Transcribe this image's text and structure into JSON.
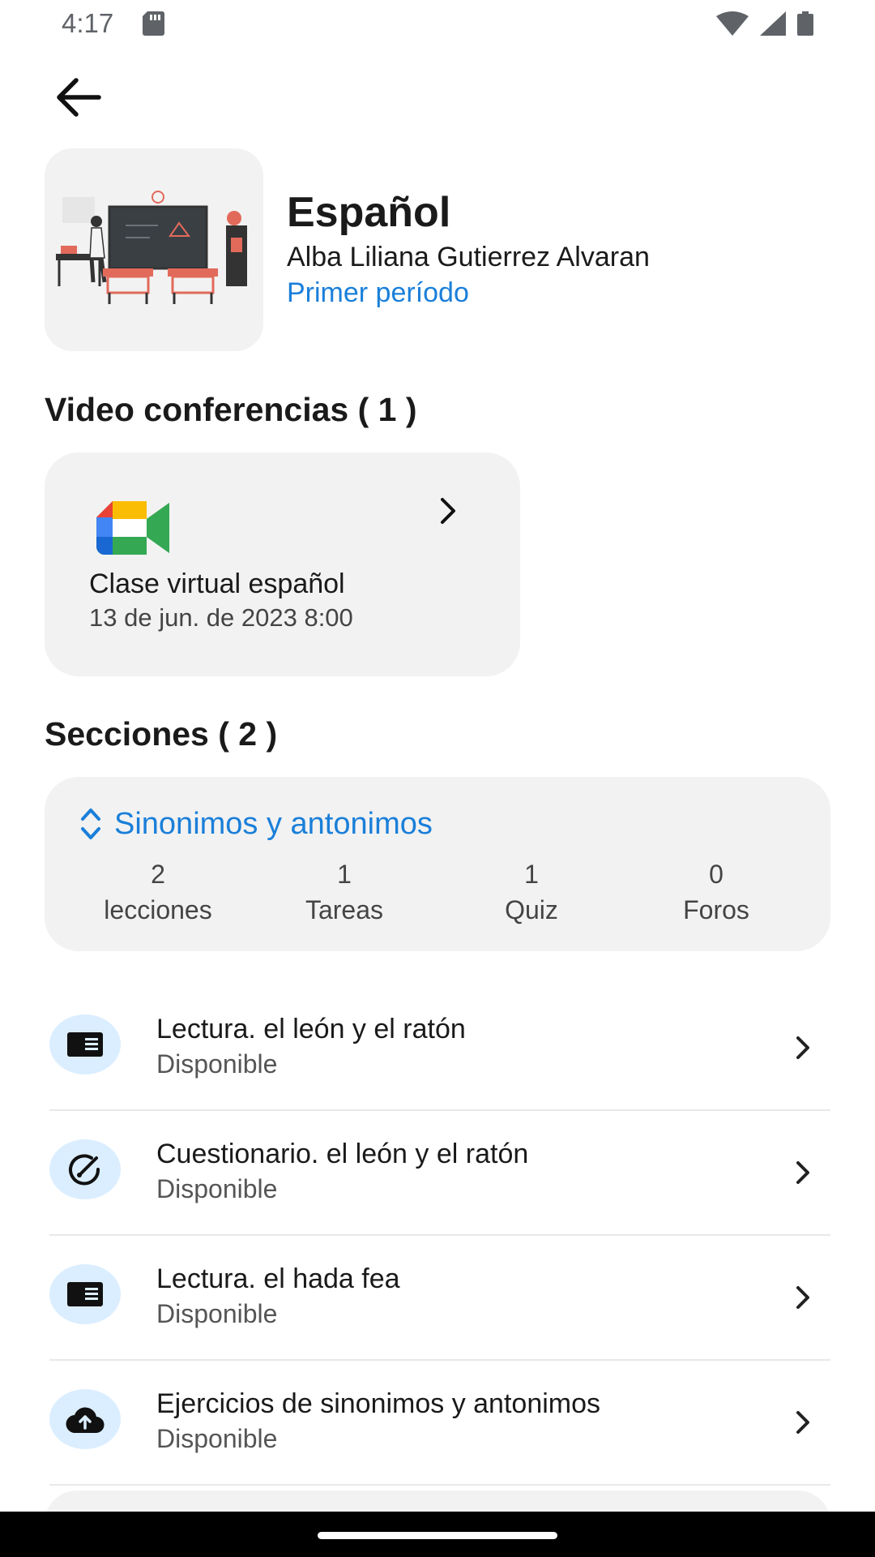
{
  "status_bar": {
    "time": "4:17"
  },
  "course": {
    "title": "Español",
    "teacher": "Alba Liliana Gutierrez Alvaran",
    "period": "Primer período"
  },
  "video_conferences": {
    "heading": "Video conferencias ( 1 )",
    "items": [
      {
        "title": "Clase virtual español",
        "date": "13 de jun. de 2023 8:00",
        "icon": "google-meet-logo"
      }
    ]
  },
  "sections": {
    "heading": "Secciones ( 2 )",
    "current": {
      "name": "Sinonimos y antonimos",
      "stats": [
        {
          "value": "2",
          "label": "lecciones"
        },
        {
          "value": "1",
          "label": "Tareas"
        },
        {
          "value": "1",
          "label": "Quiz"
        },
        {
          "value": "0",
          "label": "Foros"
        }
      ]
    },
    "items": [
      {
        "title": "Lectura. el león y el ratón",
        "status": "Disponible",
        "icon": "reading-icon"
      },
      {
        "title": "Cuestionario. el león y el ratón",
        "status": "Disponible",
        "icon": "quiz-icon"
      },
      {
        "title": "Lectura. el hada fea",
        "status": "Disponible",
        "icon": "reading-icon"
      },
      {
        "title": "Ejercicios de sinonimos y antonimos",
        "status": "Disponible",
        "icon": "cloud-upload-icon"
      }
    ]
  },
  "colors": {
    "accent": "#1a7fd9",
    "card_bg": "#f2f2f2",
    "icon_bg": "#dbeeff"
  }
}
